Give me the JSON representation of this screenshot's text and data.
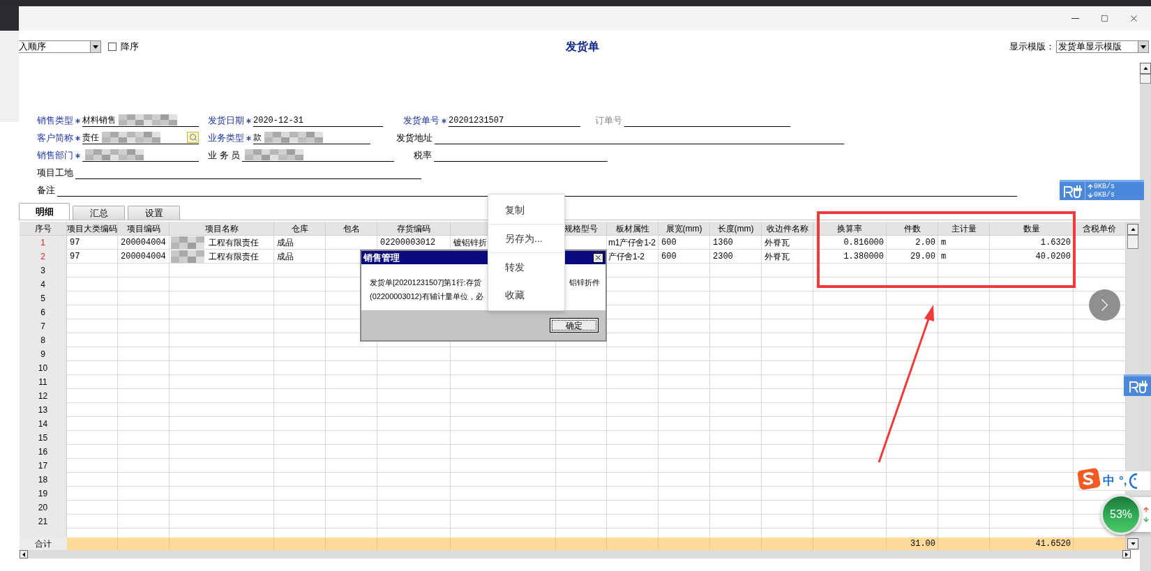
{
  "toolbar": {
    "sort": {
      "value": "入顺序"
    },
    "descending": {
      "label": "降序",
      "checked": false
    },
    "title": "发货单",
    "template": {
      "label": "显示模版：",
      "value": "发货单显示模版"
    }
  },
  "form": {
    "rows": [
      [
        {
          "label": "销售类型",
          "kind": "key",
          "required": true,
          "value": "材料销售",
          "redacted": true,
          "lookup": false
        },
        {
          "label": "发货日期",
          "kind": "key",
          "required": true,
          "value": "2020-12-31",
          "redacted": false,
          "lookup": false
        },
        {
          "label": "发货单号",
          "kind": "key",
          "required": true,
          "value": "20201231507",
          "redacted": false,
          "lookup": false
        },
        {
          "label": "订单号",
          "kind": "muted",
          "required": false,
          "redacted": false,
          "lookup": false
        }
      ],
      [
        {
          "label": "客户简称",
          "kind": "key",
          "required": true,
          "value": "责任",
          "redacted": true,
          "lookup": true
        },
        {
          "label": "业务类型",
          "kind": "key",
          "required": true,
          "value": "款",
          "redacted": true,
          "lookup": false
        },
        {
          "label": "发货地址",
          "kind": "plain",
          "required": false,
          "redacted": false,
          "lookup": false
        }
      ],
      [
        {
          "label": "销售部门",
          "kind": "key",
          "required": true,
          "redacted": true,
          "lookup": false
        },
        {
          "label": "业 务 员",
          "kind": "plain",
          "required": false,
          "redacted": true,
          "lookup": false
        },
        {
          "label": "税率",
          "kind": "plain",
          "required": false,
          "redacted": false,
          "lookup": false
        }
      ],
      [
        {
          "label": "项目工地",
          "kind": "plain",
          "required": false,
          "redacted": false,
          "lookup": false
        }
      ],
      [
        {
          "label": "备注",
          "kind": "plain",
          "required": false,
          "redacted": false,
          "lookup": false
        }
      ]
    ]
  },
  "tabs": [
    {
      "label": "明细",
      "selected": true
    },
    {
      "label": "汇总",
      "selected": false
    },
    {
      "label": "设置",
      "selected": false
    }
  ],
  "table": {
    "columns": [
      "序号",
      "项目大类编码",
      "项目编码",
      "项目名称",
      "仓库",
      "包名",
      "存货编码",
      null,
      "规格型号",
      "板材属性",
      "展宽(mm)",
      "长度(mm)",
      "收边件名称",
      "换算率",
      "件数",
      "主计量",
      "数量",
      "含税单价"
    ],
    "rows": [
      {
        "label": "1",
        "marked": true,
        "redacted": true,
        "cells": [
          "97",
          "200004004",
          "工程有限责任",
          "成品",
          null,
          "02200003012",
          "镀铝锌折",
          null,
          "m1产仔舍1-2",
          "600",
          "1360",
          "外脊瓦",
          "0.816000",
          "2.00",
          "m",
          "1.6320",
          null
        ]
      },
      {
        "label": "2",
        "marked": true,
        "redacted": true,
        "cells": [
          "97",
          "200004004",
          "工程有限责任",
          "成品",
          null,
          null,
          null,
          null,
          "产仔舍1-2",
          "600",
          "2300",
          "外脊瓦",
          "1.380000",
          "29.00",
          "m",
          "40.0200",
          null
        ]
      },
      {
        "label": "3",
        "marked": false,
        "redacted": false
      },
      {
        "label": "4",
        "marked": false,
        "redacted": false
      },
      {
        "label": "5",
        "marked": false,
        "redacted": false
      },
      {
        "label": "6",
        "marked": false,
        "redacted": false
      },
      {
        "label": "7",
        "marked": false,
        "redacted": false
      },
      {
        "label": "8",
        "marked": false,
        "redacted": false
      },
      {
        "label": "9",
        "marked": false,
        "redacted": false
      },
      {
        "label": "10",
        "marked": false,
        "redacted": false
      },
      {
        "label": "11",
        "marked": false,
        "redacted": false
      },
      {
        "label": "12",
        "marked": false,
        "redacted": false
      },
      {
        "label": "13",
        "marked": false,
        "redacted": false
      },
      {
        "label": "14",
        "marked": false,
        "redacted": false
      },
      {
        "label": "15",
        "marked": false,
        "redacted": false
      },
      {
        "label": "16",
        "marked": false,
        "redacted": false
      },
      {
        "label": "17",
        "marked": false,
        "redacted": false
      },
      {
        "label": "18",
        "marked": false,
        "redacted": false
      },
      {
        "label": "19",
        "marked": false,
        "redacted": false
      },
      {
        "label": "20",
        "marked": false,
        "redacted": false
      },
      {
        "label": "21",
        "marked": false,
        "redacted": false
      }
    ],
    "total": {
      "label": "合计",
      "cells": [
        null,
        null,
        null,
        null,
        null,
        null,
        null,
        null,
        null,
        null,
        null,
        null,
        null,
        "31.00",
        null,
        "41.6520",
        null
      ]
    }
  },
  "dialog": {
    "title": "销售管理",
    "lines": [
      [
        "发货单[20201231507]第1行:存货",
        "铝锌折件"
      ],
      [
        "(02200003012)有辅计量单位，必"
      ]
    ],
    "button": "确定"
  },
  "context_menu": [
    {
      "label": "复制",
      "separator_after": true
    },
    {
      "label": "另存为...",
      "separator_after": true
    },
    {
      "label": "转发",
      "separator_after": false
    },
    {
      "label": "收藏",
      "separator_after": false
    }
  ],
  "network": {
    "upload": "0KB/s",
    "download": "0KB/s"
  },
  "ime": {
    "language": "中",
    "punctuation": "°,"
  },
  "usage_ball": {
    "reading": "53%"
  }
}
